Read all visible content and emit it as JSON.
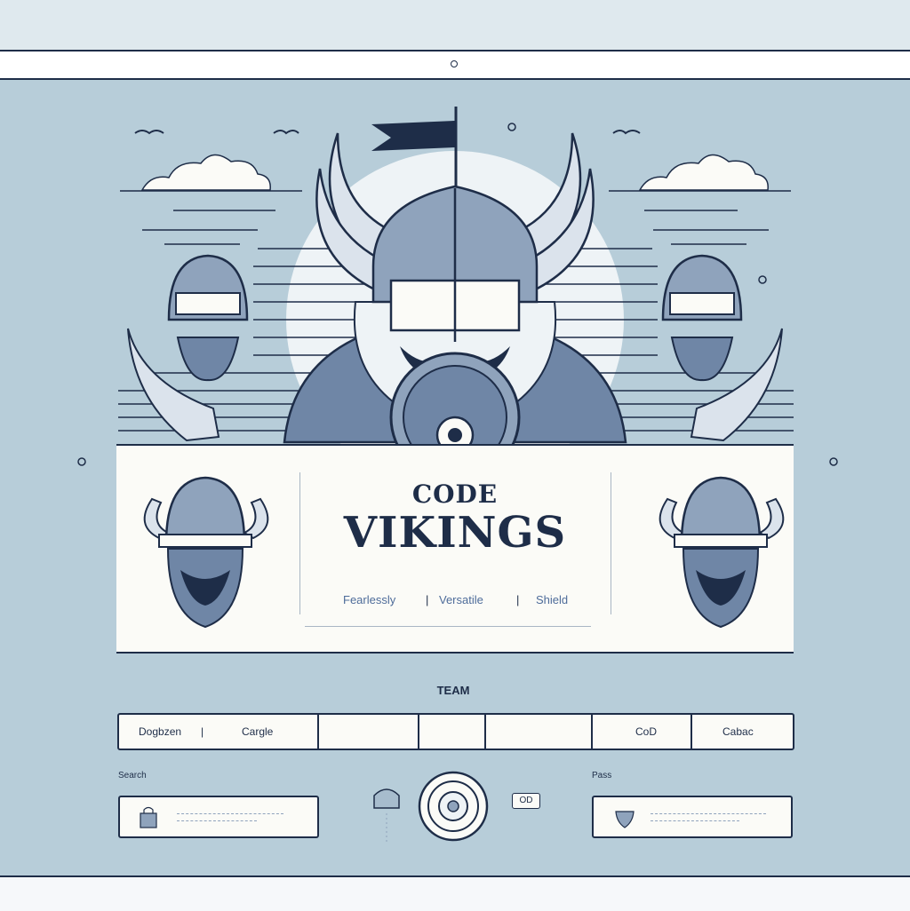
{
  "window": {
    "title_dot": "o"
  },
  "banner": {
    "title_top": "CODE",
    "title_main": "VIKINGS",
    "tags": [
      "Fearlessly",
      "Versatile",
      "Shield"
    ]
  },
  "team_label": "TEAM",
  "tabs": [
    "Dogbzen",
    "Cargle",
    "",
    "",
    "",
    "CoD",
    "Cabac"
  ],
  "left_field": {
    "label": "Search",
    "placeholder": ""
  },
  "right_field": {
    "label": "Pass",
    "placeholder": ""
  },
  "badge": {
    "label": "OD"
  },
  "colors": {
    "navy": "#1e2d48",
    "background": "#b7cdd9",
    "panel": "#fbfbf7",
    "steel": "#8fa3bc"
  },
  "icons": [
    "flag-icon",
    "viking-helmet-icon",
    "shield-icon",
    "cloud-icon",
    "bird-icon",
    "lock-icon",
    "target-button-icon"
  ]
}
